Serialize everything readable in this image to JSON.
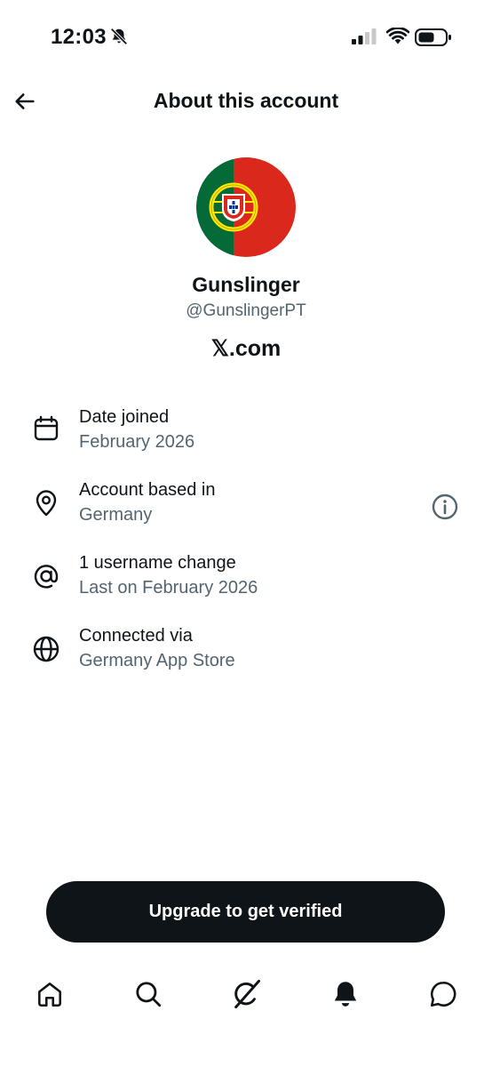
{
  "status_bar": {
    "time": "12:03"
  },
  "header": {
    "title": "About this account"
  },
  "profile": {
    "display_name": "Gunslinger",
    "handle": "@GunslingerPT",
    "platform": "𝕏.com"
  },
  "details": [
    {
      "label": "Date joined",
      "value": "February 2026",
      "icon": "calendar-icon"
    },
    {
      "label": "Account based in",
      "value": "Germany",
      "icon": "location-pin-icon"
    },
    {
      "label": "1 username change",
      "value": "Last on February 2026",
      "icon": "at-sign-icon"
    },
    {
      "label": "Connected via",
      "value": "Germany App Store",
      "icon": "globe-icon"
    }
  ],
  "cta": {
    "label": "Upgrade to get verified"
  },
  "tabs": [
    "home-icon",
    "search-icon",
    "grok-icon",
    "notifications-icon",
    "messages-icon"
  ],
  "colors": {
    "text": "#0f1419",
    "secondary": "#536471",
    "button": "#0f1419",
    "flag_green": "#046a38",
    "flag_red": "#da291c"
  }
}
